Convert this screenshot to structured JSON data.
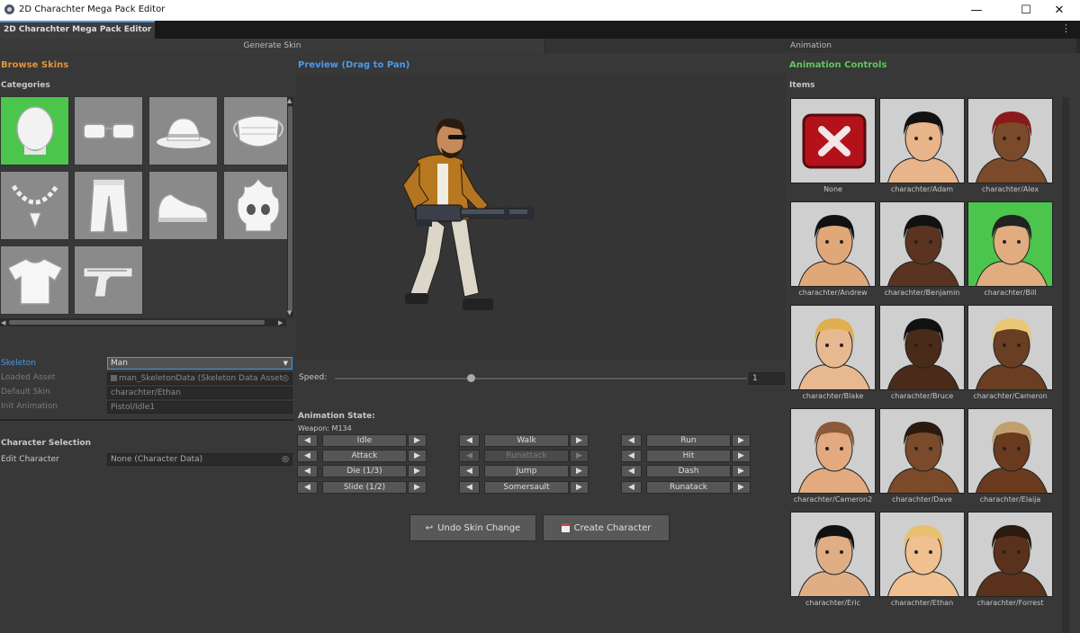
{
  "window": {
    "title": "2D Charachter Mega Pack Editor"
  },
  "tabbar": {
    "doc_tab": "2D Charachter Mega Pack Editor"
  },
  "top_tabs": {
    "generate": "Generate Skin",
    "animation": "Animation"
  },
  "browse": {
    "title": "Browse Skins",
    "categories_label": "Categories",
    "categories": [
      {
        "icon": "head-icon",
        "selected": true
      },
      {
        "icon": "glasses-icon"
      },
      {
        "icon": "hat-icon"
      },
      {
        "icon": "face-mask-icon"
      },
      {
        "icon": "necklace-icon"
      },
      {
        "icon": "pants-icon"
      },
      {
        "icon": "sneakers-icon"
      },
      {
        "icon": "flame-skull-icon"
      },
      {
        "icon": "tshirt-icon"
      },
      {
        "icon": "pistol-icon"
      }
    ]
  },
  "props": {
    "skeleton_label": "Skeleton",
    "skeleton_value": "Man",
    "loaded_asset_label": "Loaded Asset",
    "loaded_asset_value": "man_SkeletonData (Skeleton Data Asset",
    "default_skin_label": "Default Skin",
    "default_skin_value": "charachter/Ethan",
    "init_anim_label": "Init Animation",
    "init_anim_value": "Pistol/Idle1"
  },
  "char_sel": {
    "title": "Character Selection",
    "edit_label": "Edit Character",
    "edit_value": "None (Character Data)"
  },
  "preview": {
    "title": "Preview (Drag to Pan)"
  },
  "speed": {
    "label": "Speed:",
    "value": "1",
    "level": 0.33
  },
  "anim": {
    "state_label": "Animation State:",
    "weapon_label": "Weapon: M134",
    "buttons": [
      {
        "label": "Idle",
        "enabled": true
      },
      {
        "label": "Walk",
        "enabled": true
      },
      {
        "label": "Run",
        "enabled": true
      },
      {
        "label": "Attack",
        "enabled": true
      },
      {
        "label": "Runattack",
        "enabled": false
      },
      {
        "label": "Hit",
        "enabled": true
      },
      {
        "label": "Die (1/3)",
        "enabled": true
      },
      {
        "label": "Jump",
        "enabled": true
      },
      {
        "label": "Dash",
        "enabled": true
      },
      {
        "label": "Slide (1/2)",
        "enabled": true
      },
      {
        "label": "Somersault",
        "enabled": true
      },
      {
        "label": "Runatack",
        "enabled": true
      }
    ]
  },
  "actions": {
    "undo": "Undo Skin Change",
    "create": "Create Character"
  },
  "anim_controls": {
    "title": "Animation Controls",
    "items_label": "Items",
    "items": [
      {
        "name": "None"
      },
      {
        "name": "charachter/Adam"
      },
      {
        "name": "charachter/Alex"
      },
      {
        "name": "charachter/Andrew"
      },
      {
        "name": "charachter/Benjamin"
      },
      {
        "name": "charachter/Bill",
        "selected": true
      },
      {
        "name": "charachter/Blake"
      },
      {
        "name": "charachter/Bruce"
      },
      {
        "name": "charachter/Cameron"
      },
      {
        "name": "charachter/Cameron2"
      },
      {
        "name": "charachter/Dave"
      },
      {
        "name": "charachter/Elaija"
      },
      {
        "name": "charachter/Eric"
      },
      {
        "name": "charachter/Ethan"
      },
      {
        "name": "charachter/Forrest"
      }
    ]
  },
  "colors": {
    "accent_orange": "#e8913a",
    "accent_blue": "#4a9be8",
    "accent_green": "#5cc95c",
    "selected_green": "#4bc54b"
  }
}
